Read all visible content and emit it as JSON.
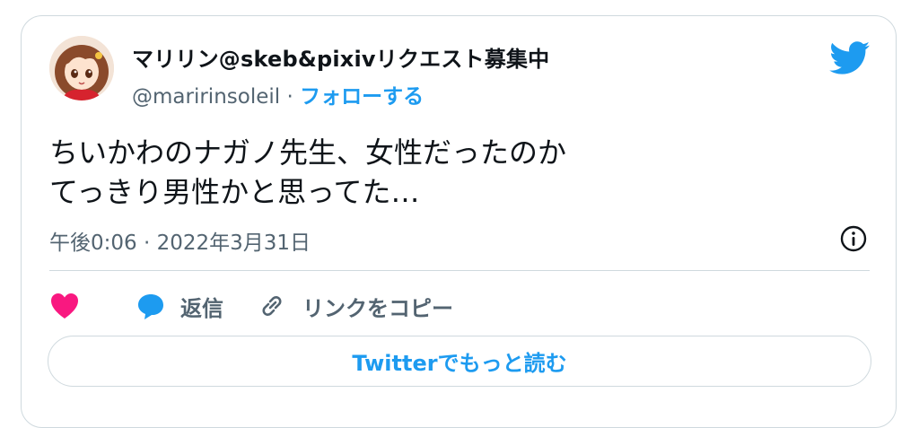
{
  "tweet": {
    "display_name": "マリリン@skeb&pixivリクエスト募集中",
    "handle": "@maririnsoleil",
    "separator": "·",
    "follow_label": "フォローする",
    "text_lines": [
      "ちいかわのナガノ先生、女性だったのか",
      "てっきり男性かと思ってた…"
    ],
    "timestamp": "午後0:06 · 2022年3月31日"
  },
  "actions": {
    "reply_label": "返信",
    "copy_link_label": "リンクをコピー"
  },
  "read_more_label": "Twitterでもっと読む",
  "colors": {
    "accent": "#1d9bf0",
    "like": "#f91880",
    "text": "#0f1419",
    "secondary": "#536471",
    "border": "#cfd9de"
  },
  "icons": [
    "avatar",
    "twitter-bird-icon",
    "info-icon",
    "heart-icon",
    "reply-bubble-icon",
    "link-icon"
  ]
}
